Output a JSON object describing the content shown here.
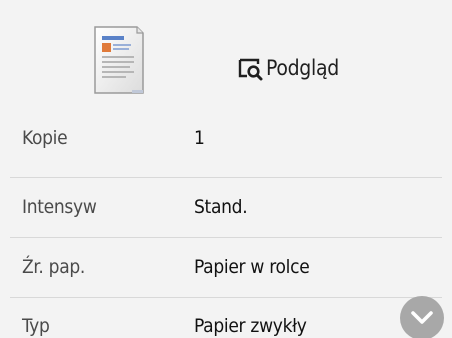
{
  "header": {
    "document_icon": "document-thumbnail-icon",
    "preview": {
      "icon": "preview-magnifier-icon",
      "label": "Podgląd"
    }
  },
  "settings": [
    {
      "label": "Kopie",
      "value": "1"
    },
    {
      "label": "Intensyw",
      "value": "Stand."
    },
    {
      "label": "Źr. pap.",
      "value": "Papier w rolce"
    },
    {
      "label": "Typ",
      "value": "Papier zwykły"
    }
  ],
  "scroll_button": {
    "icon": "chevron-down-icon"
  },
  "colors": {
    "background": "#f3f3f3",
    "divider": "#d8d8d8",
    "scroll_button": "#a8a8a8"
  }
}
